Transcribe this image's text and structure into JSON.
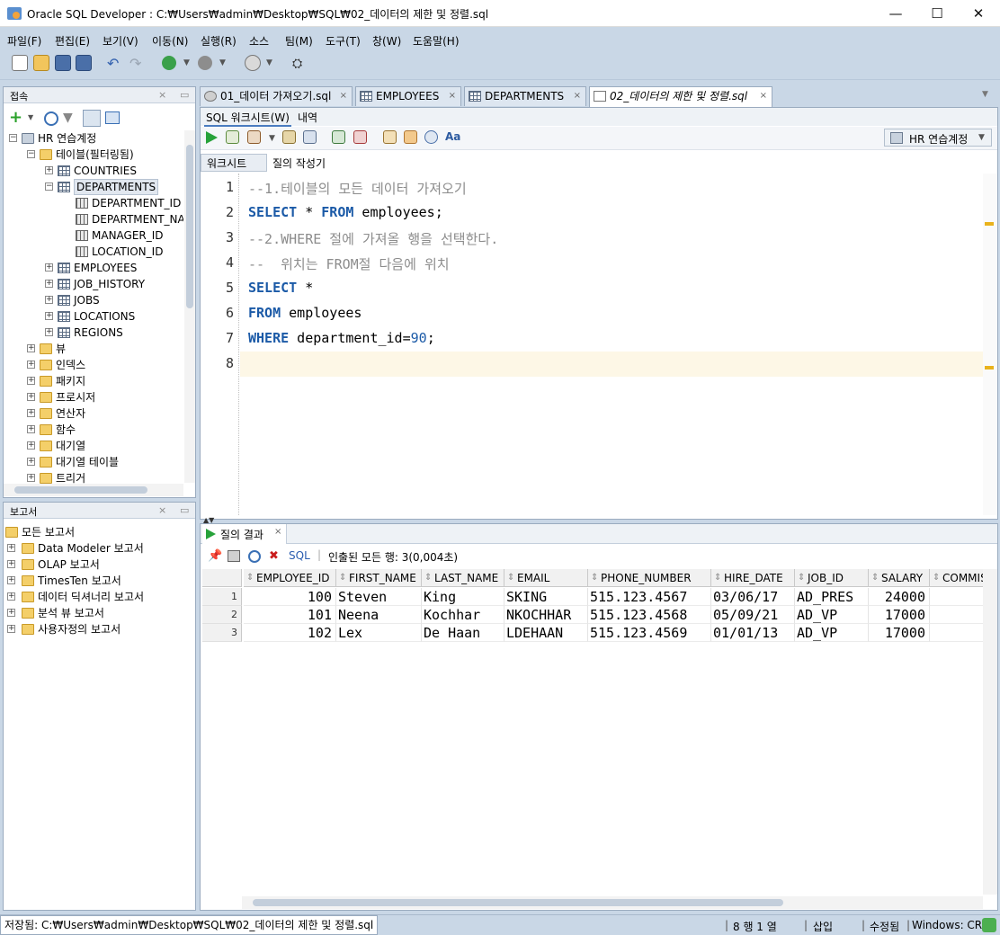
{
  "window": {
    "title": "Oracle SQL Developer : C:₩Users₩admin₩Desktop₩SQL₩02_데이터의 제한 및 정렬.sql",
    "minimize": "—",
    "maximize": "☐",
    "close": "✕"
  },
  "menu": [
    "파일(F)",
    "편집(E)",
    "보기(V)",
    "이동(N)",
    "실행(R)",
    "소스",
    "팀(M)",
    "도구(T)",
    "창(W)",
    "도움말(H)"
  ],
  "connections_panel": {
    "title": "접속",
    "tree": [
      {
        "label": "HR 연습계정",
        "level": 0,
        "expander": "−",
        "icon": "connection-icon"
      },
      {
        "label": "테이블(필터링됨)",
        "level": 1,
        "expander": "−",
        "icon": "folder-icon"
      },
      {
        "label": "COUNTRIES",
        "level": 2,
        "expander": "+",
        "icon": "table-icon"
      },
      {
        "label": "DEPARTMENTS",
        "level": 2,
        "expander": "−",
        "icon": "table-icon",
        "selected": true
      },
      {
        "label": "DEPARTMENT_ID",
        "level": 3,
        "expander": "",
        "icon": "column-icon"
      },
      {
        "label": "DEPARTMENT_NAME",
        "level": 3,
        "expander": "",
        "icon": "column-icon"
      },
      {
        "label": "MANAGER_ID",
        "level": 3,
        "expander": "",
        "icon": "column-icon"
      },
      {
        "label": "LOCATION_ID",
        "level": 3,
        "expander": "",
        "icon": "column-icon"
      },
      {
        "label": "EMPLOYEES",
        "level": 2,
        "expander": "+",
        "icon": "table-icon"
      },
      {
        "label": "JOB_HISTORY",
        "level": 2,
        "expander": "+",
        "icon": "table-icon"
      },
      {
        "label": "JOBS",
        "level": 2,
        "expander": "+",
        "icon": "table-icon"
      },
      {
        "label": "LOCATIONS",
        "level": 2,
        "expander": "+",
        "icon": "table-icon"
      },
      {
        "label": "REGIONS",
        "level": 2,
        "expander": "+",
        "icon": "table-icon"
      },
      {
        "label": "뷰",
        "level": 1,
        "expander": "+",
        "icon": "folder-icon"
      },
      {
        "label": "인덱스",
        "level": 1,
        "expander": "+",
        "icon": "folder-icon"
      },
      {
        "label": "패키지",
        "level": 1,
        "expander": "+",
        "icon": "folder-icon"
      },
      {
        "label": "프로시저",
        "level": 1,
        "expander": "+",
        "icon": "folder-icon"
      },
      {
        "label": "연산자",
        "level": 1,
        "expander": "+",
        "icon": "folder-icon"
      },
      {
        "label": "함수",
        "level": 1,
        "expander": "+",
        "icon": "folder-icon"
      },
      {
        "label": "대기열",
        "level": 1,
        "expander": "+",
        "icon": "folder-icon"
      },
      {
        "label": "대기열 테이블",
        "level": 1,
        "expander": "+",
        "icon": "folder-icon"
      },
      {
        "label": "트리거",
        "level": 1,
        "expander": "+",
        "icon": "folder-icon"
      }
    ]
  },
  "reports_panel": {
    "title": "보고서",
    "items": [
      {
        "label": "모든 보고서",
        "level": 0
      },
      {
        "label": "Data Modeler 보고서",
        "level": 1
      },
      {
        "label": "OLAP 보고서",
        "level": 1
      },
      {
        "label": "TimesTen 보고서",
        "level": 1
      },
      {
        "label": "데이터 딕셔너리 보고서",
        "level": 1
      },
      {
        "label": "분석 뷰 보고서",
        "level": 1
      },
      {
        "label": "사용자정의 보고서",
        "level": 1
      }
    ]
  },
  "doc_tabs": [
    {
      "label": "01_데이터 가져오기.sql",
      "active": false
    },
    {
      "label": "EMPLOYEES",
      "active": false
    },
    {
      "label": "DEPARTMENTS",
      "active": false
    },
    {
      "label": "02_데이터의 제한 및 정렬.sql",
      "active": true
    }
  ],
  "worksheet": {
    "subtabs": [
      "SQL 워크시트(W)",
      "내역"
    ],
    "connection": "HR 연습계정",
    "mode_tabs": [
      "워크시트",
      "질의 작성기"
    ],
    "lines": [
      "1",
      "2",
      "3",
      "4",
      "5",
      "6",
      "7",
      "8"
    ]
  },
  "results": {
    "tab_label": "질의 결과",
    "sql_label": "SQL",
    "fetch_status": "인출된 모든 행: 3(0,004초)",
    "columns": [
      "EMPLOYEE_ID",
      "FIRST_NAME",
      "LAST_NAME",
      "EMAIL",
      "PHONE_NUMBER",
      "HIRE_DATE",
      "JOB_ID",
      "SALARY",
      "COMMIS"
    ],
    "rows": [
      {
        "n": "1",
        "cells": [
          "100",
          "Steven",
          "King",
          "SKING",
          "515.123.4567",
          "03/06/17",
          "AD_PRES",
          "24000",
          ""
        ]
      },
      {
        "n": "2",
        "cells": [
          "101",
          "Neena",
          "Kochhar",
          "NKOCHHAR",
          "515.123.4568",
          "05/09/21",
          "AD_VP",
          "17000",
          ""
        ]
      },
      {
        "n": "3",
        "cells": [
          "102",
          "Lex",
          "De Haan",
          "LDEHAAN",
          "515.123.4569",
          "01/01/13",
          "AD_VP",
          "17000",
          ""
        ]
      }
    ]
  },
  "status": {
    "saved": "저장됨: C:₩Users₩admin₩Desktop₩SQL₩02_데이터의 제한 및 정렬.sql",
    "position": "8 행 1 열",
    "insert": "삽입",
    "modified": "수정됨",
    "eol": "Windows: CR"
  },
  "colors": {
    "keyword": "#1b5aa7",
    "comment": "#8c8c8c",
    "chrome": "#c9d7e6",
    "current_line": "#fdf7e6"
  }
}
